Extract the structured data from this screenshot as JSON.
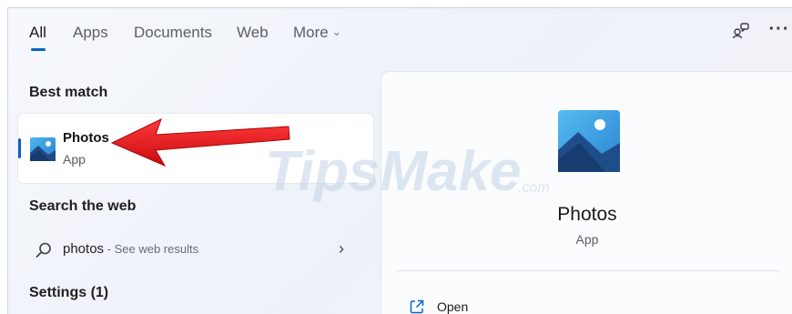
{
  "tabs": [
    {
      "label": "All",
      "active": true
    },
    {
      "label": "Apps",
      "active": false
    },
    {
      "label": "Documents",
      "active": false
    },
    {
      "label": "Web",
      "active": false
    },
    {
      "label": "More",
      "active": false
    }
  ],
  "toolbar": {
    "profile_icon": "people-switch-icon",
    "more_icon": "ellipsis-icon",
    "more_label": "···"
  },
  "best_match": {
    "section_title": "Best match",
    "app_name": "Photos",
    "app_type": "App",
    "icon": "photos-app-icon"
  },
  "search_web": {
    "section_title": "Search the web",
    "query": "photos",
    "hint": " - See web results",
    "chevron": "›"
  },
  "settings": {
    "section_title": "Settings (1)"
  },
  "detail": {
    "app_name": "Photos",
    "app_type": "App",
    "actions": [
      {
        "label": "Open",
        "icon": "open-external-icon"
      }
    ]
  },
  "watermark": {
    "text": "TipsMake",
    "suffix": ".com"
  },
  "colors": {
    "accent": "#0a62c9",
    "annotation_arrow": "#e8161b"
  }
}
